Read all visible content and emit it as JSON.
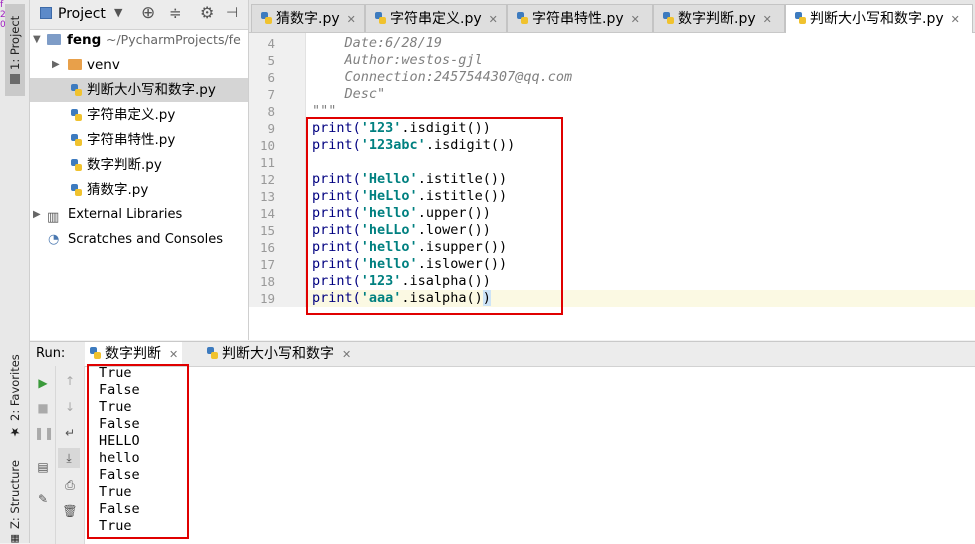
{
  "left_stripe": {
    "project_tab": "1: Project",
    "favorites_tab": "2: Favorites",
    "structure_tab": "Z: Structure"
  },
  "project_panel": {
    "title": "Project",
    "root_name": "feng",
    "root_path": "~/PycharmProjects/fe",
    "items": [
      {
        "label": "venv"
      },
      {
        "label": "判断大小写和数字.py"
      },
      {
        "label": "字符串定义.py"
      },
      {
        "label": "字符串特性.py"
      },
      {
        "label": "数字判断.py"
      },
      {
        "label": "猜数字.py"
      }
    ],
    "external_libraries": "External Libraries",
    "scratches": "Scratches and Consoles"
  },
  "editor": {
    "tabs": [
      {
        "label": "猜数字.py"
      },
      {
        "label": "字符串定义.py"
      },
      {
        "label": "字符串特性.py"
      },
      {
        "label": "数字判断.py"
      },
      {
        "label": "判断大小写和数字.py"
      }
    ],
    "line_numbers": [
      "4",
      "5",
      "6",
      "7",
      "8",
      "9",
      "10",
      "11",
      "12",
      "13",
      "14",
      "15",
      "16",
      "17",
      "18",
      "19"
    ],
    "doc_lines": [
      "    Date:6/28/19",
      "    Author:westos-gjl",
      "    Connection:2457544307@qq.com",
      "    Desc\"",
      "\"\"\""
    ],
    "code_lines": [
      {
        "s": "'123'",
        "m": ".isdigit())"
      },
      {
        "s": "'123abc'",
        "m": ".isdigit())"
      },
      {
        "s": "'Hello'",
        "m": ".istitle())"
      },
      {
        "s": "'HeLlo'",
        "m": ".istitle())"
      },
      {
        "s": "'hello'",
        "m": ".upper())"
      },
      {
        "s": "'heLLo'",
        "m": ".lower())"
      },
      {
        "s": "'hello'",
        "m": ".isupper())"
      },
      {
        "s": "'hello'",
        "m": ".islower())"
      },
      {
        "s": "'123'",
        "m": ".isalpha())"
      },
      {
        "s": "'aaa'",
        "m": ".isalpha()"
      }
    ],
    "print_kw": "print(",
    "last_paren": ")"
  },
  "run_panel": {
    "label": "Run:",
    "tabs": [
      {
        "label": "数字判断"
      },
      {
        "label": "判断大小写和数字"
      }
    ],
    "output": [
      "True",
      "False",
      "True",
      "False",
      "HELLO",
      "hello",
      "False",
      "True",
      "False",
      "True"
    ]
  },
  "colors": {
    "highlight_box": "#e00000",
    "string": "#008080",
    "keyword": "#000080",
    "doc": "#808080"
  }
}
